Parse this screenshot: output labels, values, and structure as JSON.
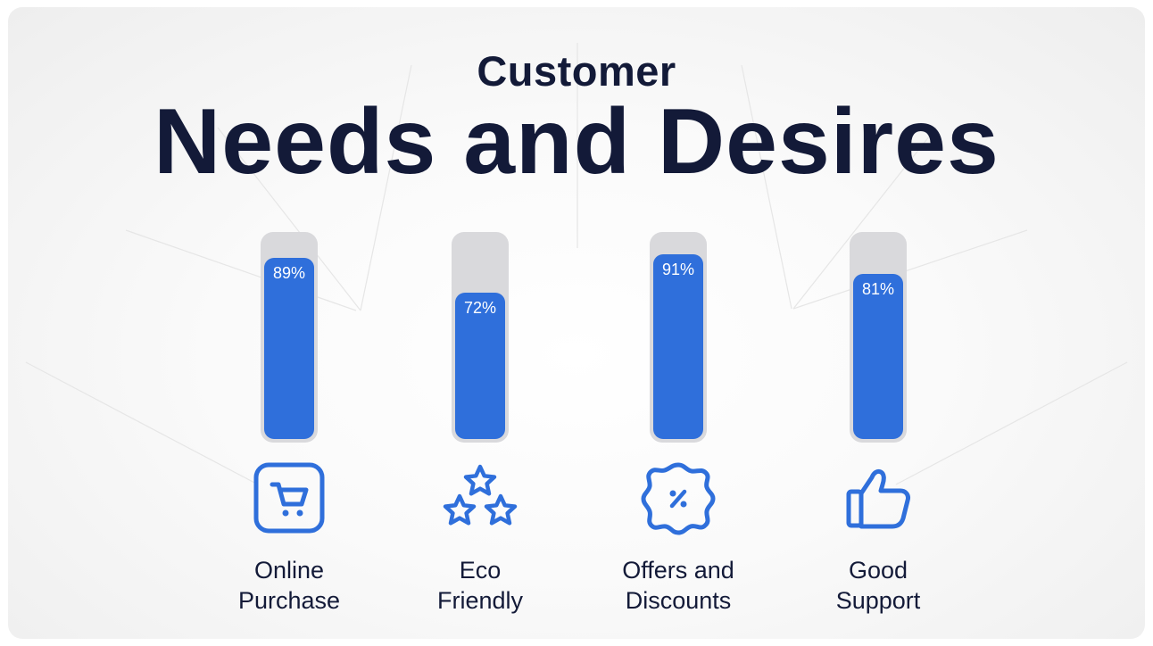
{
  "chart_data": {
    "type": "bar",
    "title": "Customer",
    "subtitle": "Needs and Desires",
    "categories": [
      "Online Purchase",
      "Eco Friendly",
      "Offers and Discounts",
      "Good Support"
    ],
    "label_lines": [
      [
        "Online",
        "Purchase"
      ],
      [
        "Eco",
        "Friendly"
      ],
      [
        "Offers and",
        "Discounts"
      ],
      [
        "Good",
        "Support"
      ]
    ],
    "values": [
      89,
      72,
      91,
      81
    ],
    "value_labels": [
      "89%",
      "72%",
      "91%",
      "81%"
    ],
    "ylim": [
      0,
      100
    ],
    "icons": [
      "shopping-cart-icon",
      "stars-icon",
      "discount-badge-icon",
      "thumbs-up-icon"
    ],
    "colors": {
      "bar": "#2f6fdb",
      "track": "#d9d9dc",
      "text": "#131a38"
    }
  }
}
